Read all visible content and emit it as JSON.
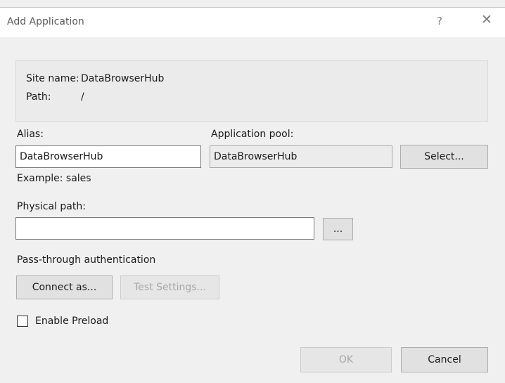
{
  "window": {
    "title": "Add Application",
    "help_glyph": "?",
    "close_glyph": "✕"
  },
  "info": {
    "site_label": "Site name:",
    "site_value": "DataBrowserHub",
    "path_label": "Path:",
    "path_value": "/"
  },
  "alias": {
    "label": "Alias:",
    "value": "DataBrowserHub",
    "example": "Example: sales"
  },
  "app_pool": {
    "label": "Application pool:",
    "value": "DataBrowserHub",
    "select_label": "Select..."
  },
  "physical_path": {
    "label": "Physical path:",
    "value": "",
    "browse_label": "..."
  },
  "auth": {
    "label": "Pass-through authentication",
    "connect_label": "Connect as...",
    "test_label": "Test Settings..."
  },
  "preload": {
    "label": "Enable Preload",
    "checked": false
  },
  "footer": {
    "ok_label": "OK",
    "cancel_label": "Cancel"
  }
}
